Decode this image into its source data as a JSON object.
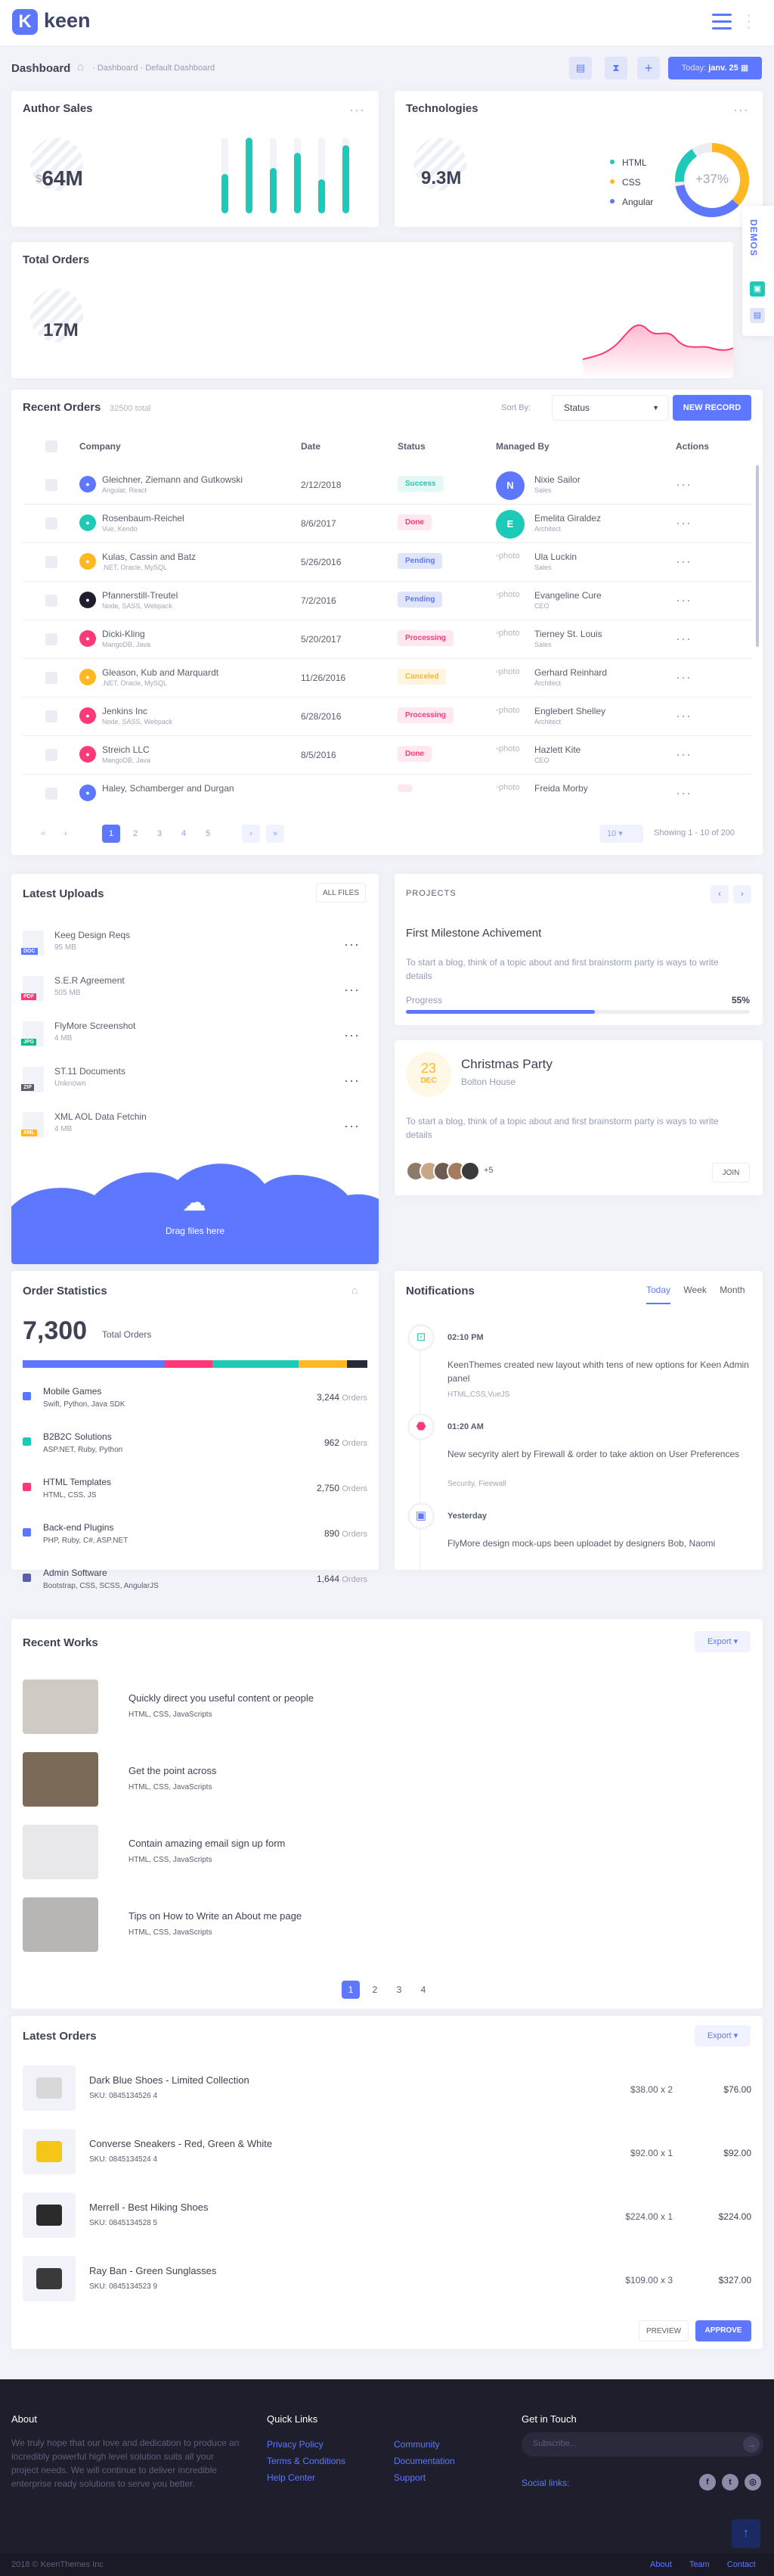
{
  "header": {
    "logo": "keen"
  },
  "subheader": {
    "title": "Dashboard",
    "crumb1": "Dashboard",
    "crumb2": "Default Dashboard",
    "date_prefix": "Today:",
    "date": "janv. 25"
  },
  "author_sales": {
    "title": "Author Sales",
    "currency": "$",
    "value": "64M"
  },
  "technologies": {
    "title": "Technologies",
    "value": "9.3M",
    "pct": "+37%",
    "legend": [
      "HTML",
      "CSS",
      "Angular"
    ]
  },
  "total_orders": {
    "title": "Total Orders",
    "value": "17M"
  },
  "demos_label": "DEMOS",
  "recent_orders": {
    "title": "Recent Orders",
    "total": "32500 total",
    "sort_label": "Sort By:",
    "sort_value": "Status",
    "new_btn": "NEW RECORD",
    "columns": [
      "Company",
      "Date",
      "Status",
      "Managed By",
      "Actions"
    ],
    "rows": [
      {
        "company": "Gleichner, Ziemann and Gutkowski",
        "sub": "Angular, React",
        "date": "2/12/2018",
        "status": "Success",
        "manager": "Nixie Sailor",
        "role": "Sales",
        "avatar": "N"
      },
      {
        "company": "Rosenbaum-Reichel",
        "sub": "Vue, Kendo",
        "date": "8/6/2017",
        "status": "Done",
        "manager": "Emelita Giraldez",
        "role": "Architect",
        "avatar": "E"
      },
      {
        "company": "Kulas, Cassin and Batz",
        "sub": ".NET, Oracle, MySQL",
        "date": "5/26/2016",
        "status": "Pending",
        "manager": "Ula Luckin",
        "role": "Sales",
        "avatar": "photo"
      },
      {
        "company": "Pfannerstill-Treutel",
        "sub": "Node, SASS, Webpack",
        "date": "7/2/2016",
        "status": "Pending",
        "manager": "Evangeline Cure",
        "role": "CEO",
        "avatar": "photo"
      },
      {
        "company": "Dicki-Kling",
        "sub": "MangoDB, Java",
        "date": "5/20/2017",
        "status": "Processing",
        "manager": "Tierney St. Louis",
        "role": "Sales",
        "avatar": "photo"
      },
      {
        "company": "Gleason, Kub and Marquardt",
        "sub": ".NET, Oracle, MySQL",
        "date": "11/26/2016",
        "status": "Canceled",
        "manager": "Gerhard Reinhard",
        "role": "Architect",
        "avatar": "photo"
      },
      {
        "company": "Jenkins Inc",
        "sub": "Node, SASS, Webpack",
        "date": "6/28/2016",
        "status": "Processing",
        "manager": "Englebert Shelley",
        "role": "Architect",
        "avatar": "photo"
      },
      {
        "company": "Streich LLC",
        "sub": "MangoDB, Java",
        "date": "8/5/2016",
        "status": "Done",
        "manager": "Hazlett Kite",
        "role": "CEO",
        "avatar": "photo"
      },
      {
        "company": "Haley, Schamberger and Durgan",
        "sub": "",
        "date": "",
        "status": "",
        "manager": "Freida Morby",
        "role": "",
        "avatar": "photo"
      }
    ],
    "pages": [
      "1",
      "2",
      "3",
      "4",
      "5"
    ],
    "per_page": "10",
    "showing": "Showing 1 - 10 of 200"
  },
  "uploads": {
    "title": "Latest Uploads",
    "btn": "ALL FILES",
    "drop": "Drag files here",
    "files": [
      {
        "name": "Keeg Design Reqs",
        "size": "95 MB",
        "ext": "DOC",
        "color": "#5d78ff"
      },
      {
        "name": "S.E.R Agreement",
        "size": "505 MB",
        "ext": "PDF",
        "color": "#fd397a"
      },
      {
        "name": "FlyMore Screenshot",
        "size": "4 MB",
        "ext": "JPG",
        "color": "#0abb87"
      },
      {
        "name": "ST.11 Documents",
        "size": "Unknown",
        "ext": "ZIP",
        "color": "#595d6e"
      },
      {
        "name": "XML AOL Data Fetchin",
        "size": "4 MB",
        "ext": "XML",
        "color": "#ffb822"
      }
    ]
  },
  "projects": {
    "label": "PROJECTS",
    "title": "First Milestone Achivement",
    "desc": "To start a blog, think of a topic about and first brainstorm party is ways to write details",
    "progress_label": "Progress",
    "progress": "55%"
  },
  "event": {
    "day": "23",
    "month": "DEC",
    "title": "Christmas Party",
    "place": "Bolton House",
    "desc": "To start a blog, think of a topic about and first brainstorm party is ways to write details",
    "more": "+5",
    "join": "JOIN"
  },
  "order_stats": {
    "title": "Order Statistics",
    "total": "7,300",
    "total_label": "Total Orders",
    "items": [
      {
        "name": "Mobile Games",
        "tech": "Swift, Python, Java SDK",
        "count": "3,244",
        "color": "#5d78ff"
      },
      {
        "name": "B2B2C Solutions",
        "tech": "ASP.NET, Ruby, Python",
        "count": "962",
        "color": "#1dc9b7"
      },
      {
        "name": "HTML Templates",
        "tech": "HTML, CSS, JS",
        "count": "2,750",
        "color": "#fd397a"
      },
      {
        "name": "Back-end Plugins",
        "tech": "PHP, Ruby, C#, ASP.NET",
        "count": "890",
        "color": "#5d78ff"
      },
      {
        "name": "Admin Software",
        "tech": "Bootstrap, CSS, SCSS, AngularJS",
        "count": "1,644",
        "color": "#5c5fa8"
      }
    ],
    "unit": "Orders"
  },
  "notifications": {
    "title": "Notifications",
    "tabs": [
      "Today",
      "Week",
      "Month"
    ],
    "items": [
      {
        "time": "02:10 PM",
        "text": "KeenThemes created new layout whith tens of new options for Keen Admin panel",
        "tags": "HTML,CSS,VueJS",
        "color": "#1dc9b7"
      },
      {
        "time": "01:20 AM",
        "text": "New secyrity alert by Firewall & order to take aktion on User Preferences",
        "tags": "Security, Fieewall",
        "color": "#fd397a"
      },
      {
        "time": "Yesterday",
        "text": "FlyMore design mock-ups been uploadet by designers Bob, Naomi",
        "tags": "",
        "color": "#5d78ff"
      }
    ]
  },
  "recent_works": {
    "title": "Recent Works",
    "export": "Export",
    "items": [
      {
        "title": "Quickly direct you useful content or people",
        "tags": "HTML, CSS, JavaScripts"
      },
      {
        "title": "Get the point across",
        "tags": "HTML, CSS, JavaScripts"
      },
      {
        "title": "Contain amazing email sign up form",
        "tags": "HTML, CSS, JavaScripts"
      },
      {
        "title": "Tips on How to Write an About me page",
        "tags": "HTML, CSS, JavaScripts"
      }
    ],
    "pages": [
      "1",
      "2",
      "3",
      "4"
    ]
  },
  "latest_orders": {
    "title": "Latest Orders",
    "export": "Export",
    "items": [
      {
        "name": "Dark Blue Shoes - Limited Collection",
        "sku": "SKU: 0845134526 4",
        "qty": "$38.00 x 2",
        "total": "$76.00"
      },
      {
        "name": "Converse Sneakers - Red, Green & White",
        "sku": "SKU: 0845134524 4",
        "qty": "$92.00 x 1",
        "total": "$92.00"
      },
      {
        "name": "Merrell - Best Hiking Shoes",
        "sku": "SKU: 0845134528 5",
        "qty": "$224.00 x 1",
        "total": "$224.00"
      },
      {
        "name": "Ray Ban - Green Sunglasses",
        "sku": "SKU: 0845134523 9",
        "qty": "$109.00 x 3",
        "total": "$327.00"
      }
    ],
    "preview": "PREVIEW",
    "approve": "APPROVE"
  },
  "footer": {
    "about_title": "About",
    "about_text": "We truly hope that our love and dedication to produce an incredibly powerful high level solution suits all your project needs. We will continue to deliver incredible enterprise ready solutions to serve you better.",
    "links_title": "Quick Links",
    "links": [
      "Privacy Policy",
      "Terms & Conditions",
      "Help Center",
      "Community",
      "Documentation",
      "Support"
    ],
    "touch_title": "Get in Touch",
    "subscribe_placeholder": "Subscribe...",
    "social": "Social links:",
    "copyright": "2018 © KeenThemes Inc",
    "bottom_links": [
      "About",
      "Team",
      "Contact"
    ]
  }
}
